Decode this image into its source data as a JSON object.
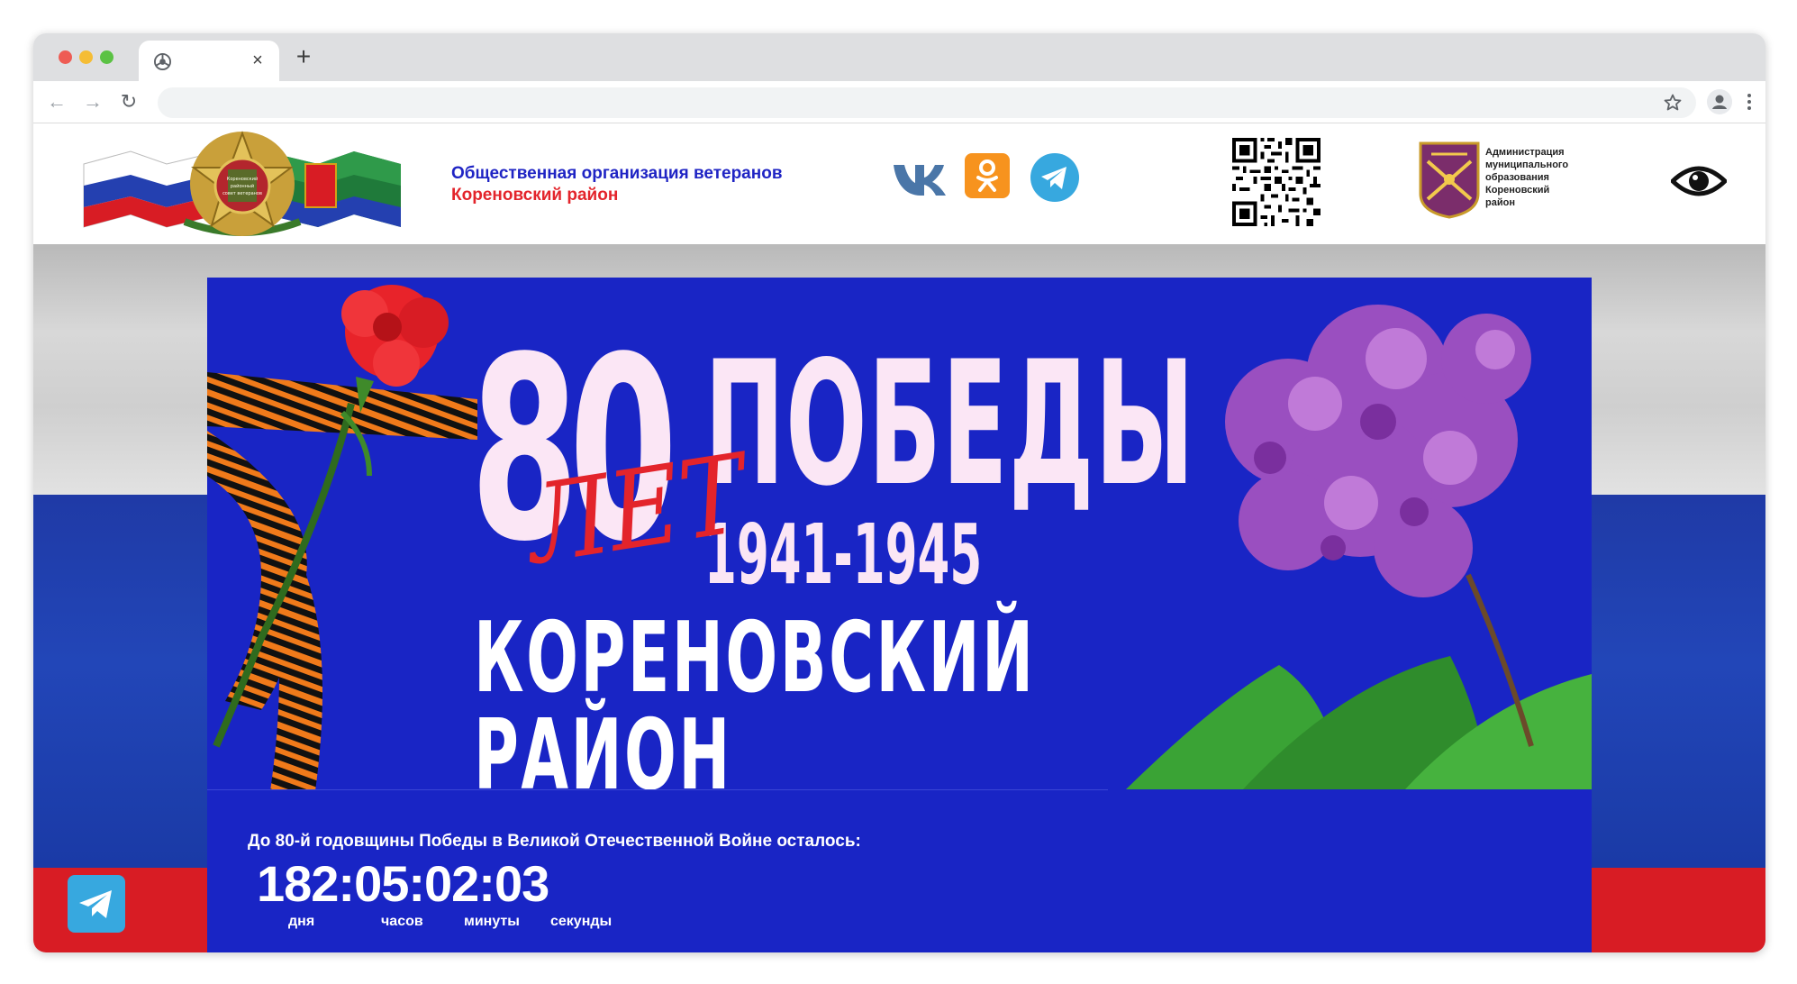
{
  "browser": {
    "tab_title": "",
    "tab_close": "×",
    "new_tab": "+",
    "back": "←",
    "forward": "→",
    "reload": "↻",
    "address_value": "",
    "address_placeholder": ""
  },
  "header": {
    "org_line1": "Общественная организация ветеранов",
    "org_line2": "Кореновский район",
    "admin_lines": [
      "Администрация",
      "муниципального",
      "образования",
      "Кореновский",
      "район"
    ],
    "logo_text": "Кореновский районный совет ветеранов"
  },
  "banner": {
    "big_number": "80",
    "script_word": "ЛЕТ",
    "headline": "ПОБЕДЫ",
    "years": "1941-1945",
    "region": "КОРЕНОВСКИЙ РАЙОН"
  },
  "countdown": {
    "label": "До 80-й годовщины Победы в Великой Отечественной Войне осталось:",
    "value": "182:05:02:03",
    "units": [
      "дня",
      "часов",
      "минуты",
      "секунды"
    ]
  },
  "colors": {
    "brand_blue": "#1925c5",
    "accent_red": "#e3242b",
    "telegram": "#37a8df",
    "ok_orange": "#f7931e"
  },
  "icons": {
    "social": [
      "vk-icon",
      "ok-icon",
      "telegram-icon"
    ],
    "accessibility": "eye-icon"
  }
}
